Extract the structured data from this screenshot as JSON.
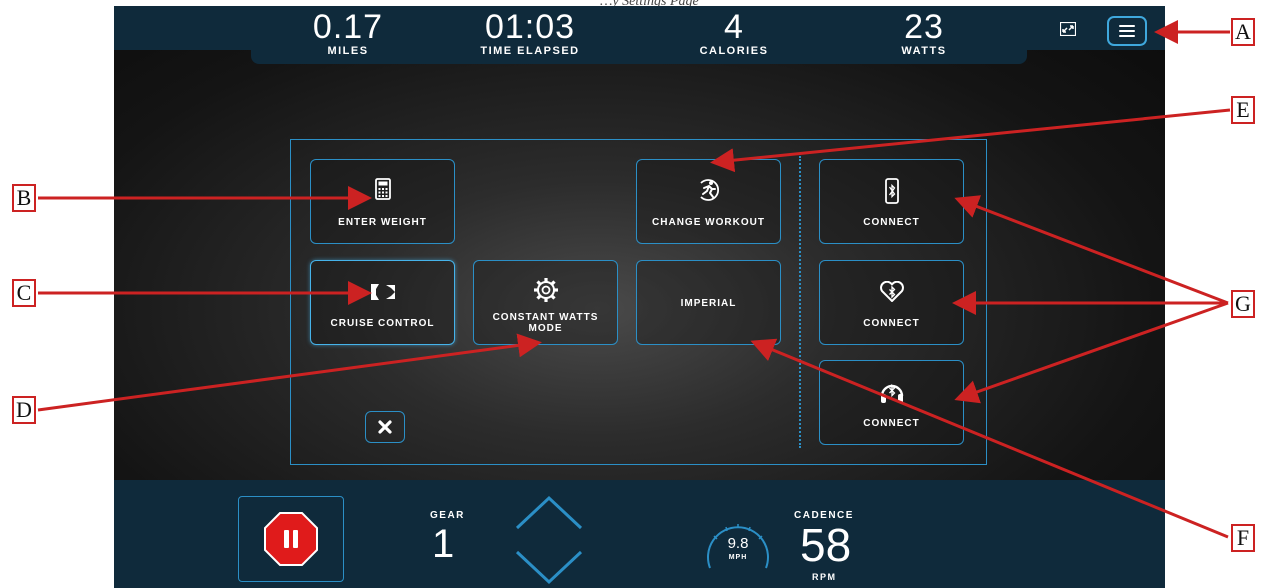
{
  "caption": "…y Settings Page",
  "stats": [
    {
      "value": "0.17",
      "label": "MILES"
    },
    {
      "value": "01:03",
      "label": "TIME ELAPSED"
    },
    {
      "value": "4",
      "label": "CALORIES"
    },
    {
      "value": "23",
      "label": "WATTS"
    }
  ],
  "tiles": {
    "enter_weight": "ENTER WEIGHT",
    "change_workout": "CHANGE WORKOUT",
    "connect_phone": "CONNECT",
    "cruise_control": "CRUISE CONTROL",
    "constant_watts": "CONSTANT WATTS MODE",
    "units": "IMPERIAL",
    "connect_heart": "CONNECT",
    "connect_headphones": "CONNECT"
  },
  "bottom": {
    "gear_label": "GEAR",
    "gear_value": "1",
    "speed_value": "9.8",
    "speed_unit": "MPH",
    "cadence_label": "CADENCE",
    "cadence_value": "58",
    "cadence_unit": "RPM"
  },
  "callouts": [
    "A",
    "B",
    "C",
    "D",
    "E",
    "F",
    "G"
  ],
  "icons": [
    "fullscreen-icon",
    "menu-icon",
    "calculator-icon",
    "workout-runner-icon",
    "bluetooth-phone-icon",
    "cruise-control-icon",
    "gear-cog-icon",
    "bluetooth-heart-icon",
    "bluetooth-headphones-icon",
    "close-icon",
    "pause-stop-icon",
    "chevron-up-icon",
    "chevron-down-icon",
    "speedometer-icon"
  ],
  "colors": {
    "accent": "#2b8fc6",
    "bar": "#0f2a3b",
    "annotation": "#cc2222",
    "stop": "#e01b1b"
  }
}
